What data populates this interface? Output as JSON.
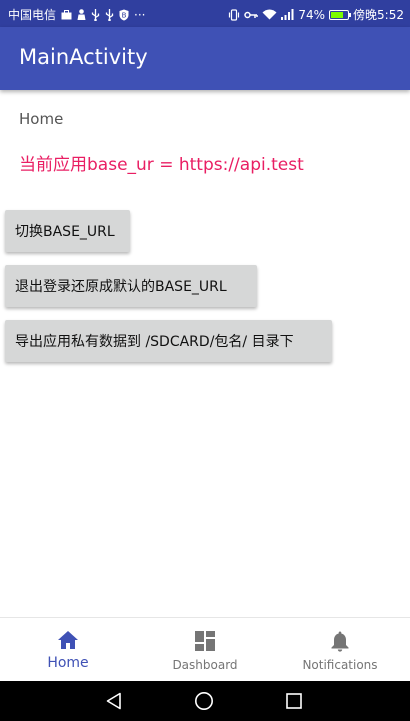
{
  "status_bar": {
    "carrier": "中国电信",
    "more": "···",
    "battery_percent": "74%",
    "battery_level": 0.74,
    "time": "傍晚5:52",
    "colors": {
      "background": "#303F9F",
      "battery_fill": "#7CFC00"
    }
  },
  "app_bar": {
    "title": "MainActivity",
    "color": "#3F51B5"
  },
  "content": {
    "fragment_label": "Home",
    "base_url_text": "当前应用base_ur = https://api.test",
    "base_url_color": "#E91E63",
    "buttons": [
      {
        "label": "切换BASE_URL"
      },
      {
        "label": "退出登录还原成默认的BASE_URL"
      },
      {
        "label": "导出应用私有数据到 /SDCARD/包名/ 目录下"
      }
    ]
  },
  "bottom_nav": {
    "items": [
      {
        "label": "Home",
        "icon": "home-icon",
        "active": true
      },
      {
        "label": "Dashboard",
        "icon": "dashboard-icon",
        "active": false
      },
      {
        "label": "Notifications",
        "icon": "bell-icon",
        "active": false
      }
    ],
    "active_color": "#3F51B5",
    "inactive_color": "#757575"
  },
  "system_nav": {
    "buttons": [
      "back-icon",
      "home-circle-icon",
      "recent-apps-icon"
    ]
  }
}
